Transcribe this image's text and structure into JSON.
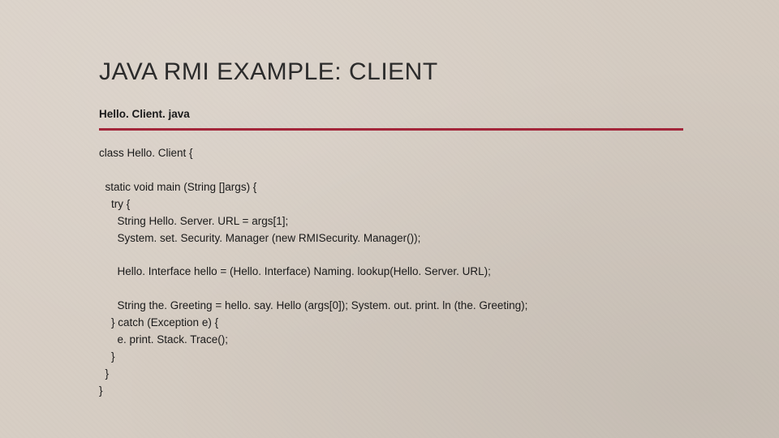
{
  "title": "JAVA RMI EXAMPLE: CLIENT",
  "filename": "Hello. Client. java",
  "code_lines": [
    "class Hello. Client {",
    "",
    "  static void main (String []args) {",
    "    try {",
    "      String Hello. Server. URL = args[1];",
    "      System. set. Security. Manager (new RMISecurity. Manager());",
    "",
    "      Hello. Interface hello = (Hello. Interface) Naming. lookup(Hello. Server. URL);",
    "",
    "      String the. Greeting = hello. say. Hello (args[0]); System. out. print. ln (the. Greeting);",
    "    } catch (Exception e) {",
    "      e. print. Stack. Trace();",
    "    }",
    "  }",
    "}"
  ]
}
